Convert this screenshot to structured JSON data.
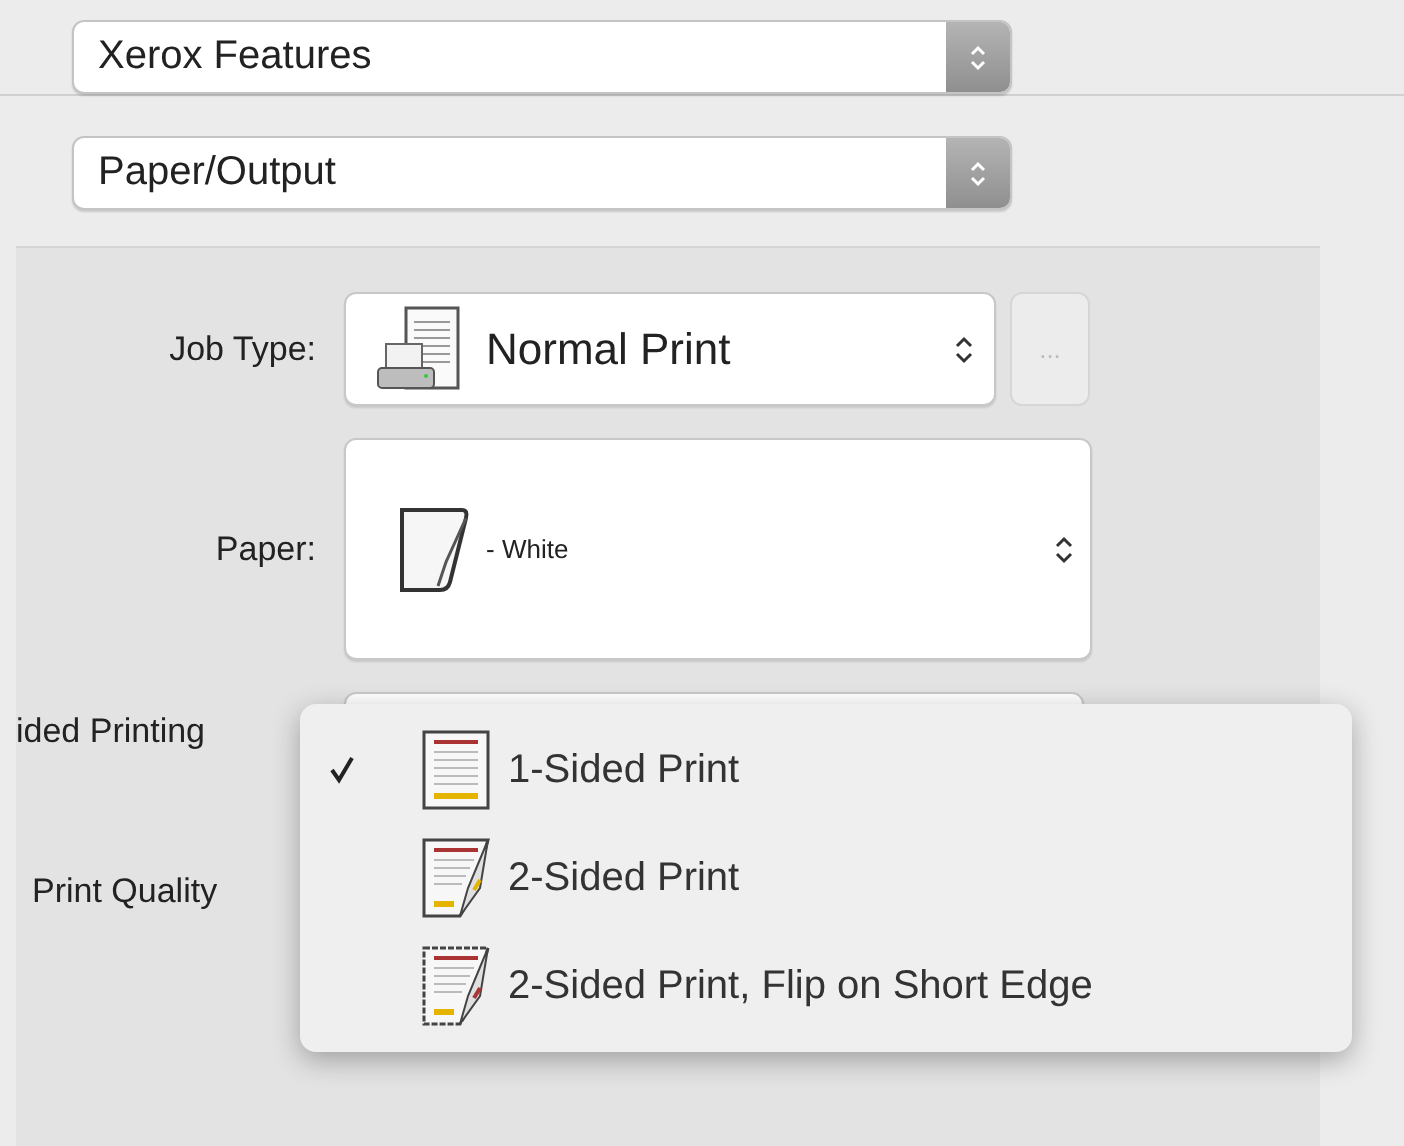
{
  "feature_menu": {
    "value": "Xerox Features"
  },
  "section_menu": {
    "value": "Paper/Output"
  },
  "fields": [
    {
      "label": "Job Type:",
      "kind": "job",
      "value": "Normal Print",
      "more_button": {
        "label": "...",
        "disabled": true
      }
    },
    {
      "label": "Paper:",
      "kind": "paper",
      "value": "- White"
    },
    {
      "label": "ided Printing",
      "kind": "covered"
    },
    {
      "label": "Print Quality",
      "kind": "label-only"
    }
  ],
  "sided_menu": {
    "items": [
      {
        "label": "1-Sided Print",
        "kind": "one-sided",
        "checked": true
      },
      {
        "label": "2-Sided Print",
        "kind": "two-sided",
        "checked": false
      },
      {
        "label": "2-Sided Print, Flip on Short Edge",
        "kind": "two-sided-flip",
        "checked": false
      }
    ]
  }
}
